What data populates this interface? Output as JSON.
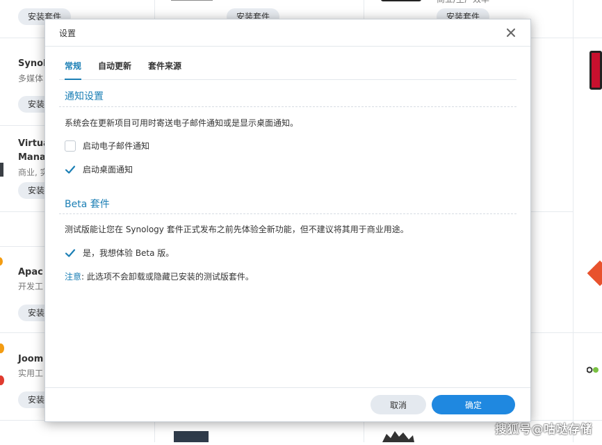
{
  "background": {
    "install_label": "安装套件",
    "install_label_short": "安装",
    "packages": [
      {
        "name": "Synol",
        "sub": "多媒体"
      },
      {
        "name": "Virtua",
        "name2": "Mana",
        "sub": "商业, 实"
      },
      {
        "name": "Apac",
        "sub": "开发工"
      },
      {
        "name": "Joom",
        "sub": "实用工"
      }
    ],
    "top_right_sub": "商业/生产效率",
    "watermark": "搜狐号@咕哒存储"
  },
  "dialog": {
    "title": "设置",
    "close_icon": "close-icon",
    "tabs": [
      {
        "label": "常规",
        "active": true
      },
      {
        "label": "自动更新",
        "active": false
      },
      {
        "label": "套件来源",
        "active": false
      }
    ],
    "notify": {
      "title": "通知设置",
      "description": "系统会在更新项目可用时寄送电子邮件通知或是显示桌面通知。",
      "email_label": "启动电子邮件通知",
      "email_checked": false,
      "desktop_label": "启动桌面通知",
      "desktop_checked": true
    },
    "beta": {
      "title": "Beta 套件",
      "description": "测试版能让您在 Synology 套件正式发布之前先体验全新功能，但不建议将其用于商业用途。",
      "opt_in_label": "是，我想体验 Beta 版。",
      "opt_in_checked": true,
      "note_key": "注意",
      "note_text": ": 此选项不会卸载或隐藏已安装的测试版套件。"
    },
    "footer": {
      "cancel_label": "取消",
      "ok_label": "确定"
    }
  },
  "colors": {
    "accent": "#1b7fb5",
    "primary_button": "#1f88e0",
    "secondary_button": "#e4e9ef"
  }
}
